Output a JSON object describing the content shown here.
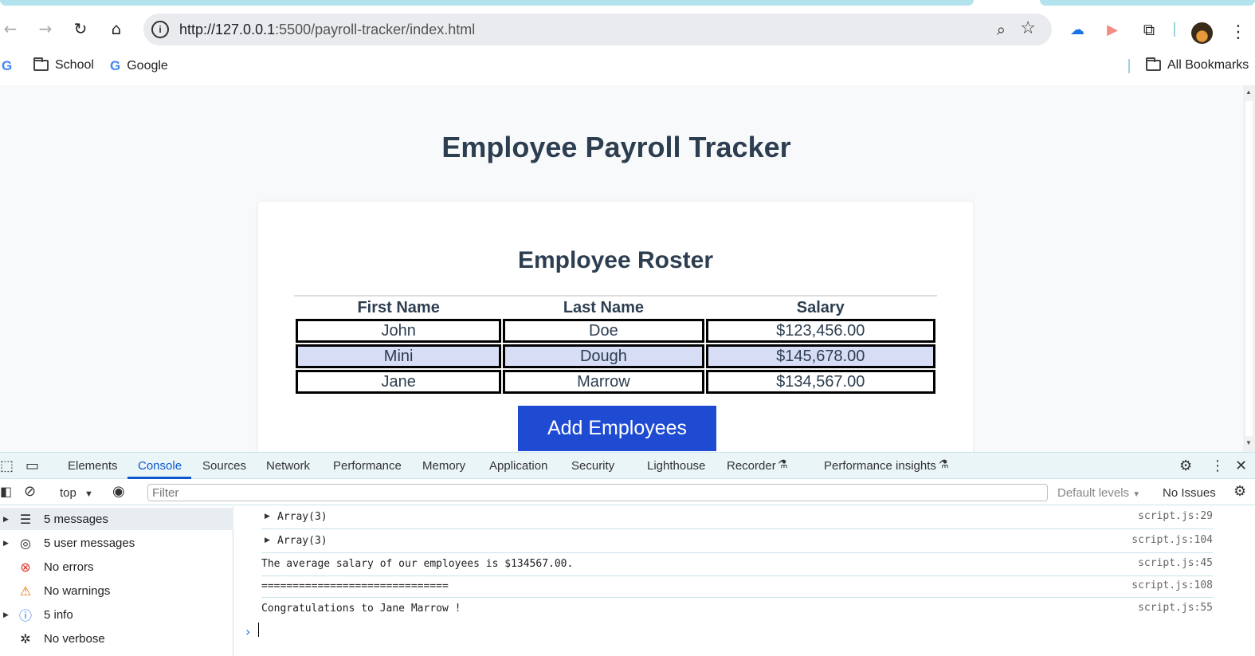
{
  "browser": {
    "url_host": "http://127.0.0.1",
    "url_rest": ":5500/payroll-tracker/index.html",
    "bookmarks": {
      "school": "School",
      "google": "Google",
      "all": "All Bookmarks"
    }
  },
  "page": {
    "title": "Employee Payroll Tracker",
    "roster_title": "Employee Roster",
    "columns": [
      "First Name",
      "Last Name",
      "Salary"
    ],
    "rows": [
      {
        "first": "John",
        "last": "Doe",
        "salary": "$123,456.00"
      },
      {
        "first": "Mini",
        "last": "Dough",
        "salary": "$145,678.00"
      },
      {
        "first": "Jane",
        "last": "Marrow",
        "salary": "$134,567.00"
      }
    ],
    "add_button": "Add Employees"
  },
  "devtools": {
    "tabs": [
      "Elements",
      "Console",
      "Sources",
      "Network",
      "Performance",
      "Memory",
      "Application",
      "Security",
      "Lighthouse",
      "Recorder",
      "Performance insights"
    ],
    "active_tab": "Console",
    "context": "top",
    "filter_placeholder": "Filter",
    "levels": "Default levels",
    "issues": "No Issues",
    "sidebar": [
      {
        "label": "5 messages",
        "icon": "list-icon"
      },
      {
        "label": "5 user messages",
        "icon": "user-icon"
      },
      {
        "label": "No errors",
        "icon": "error-icon"
      },
      {
        "label": "No warnings",
        "icon": "warning-icon"
      },
      {
        "label": "5 info",
        "icon": "info-icon"
      },
      {
        "label": "No verbose",
        "icon": "bug-icon"
      }
    ],
    "messages": [
      {
        "text": "Array(3)",
        "source": "script.js:29"
      },
      {
        "text": "Array(3)",
        "source": "script.js:104"
      },
      {
        "text": "The average salary of our employees is $134567.00.",
        "source": "script.js:45"
      },
      {
        "text": "==============================",
        "source": "script.js:108"
      },
      {
        "text": "Congratulations to Jane Marrow !",
        "source": "script.js:55"
      }
    ]
  }
}
